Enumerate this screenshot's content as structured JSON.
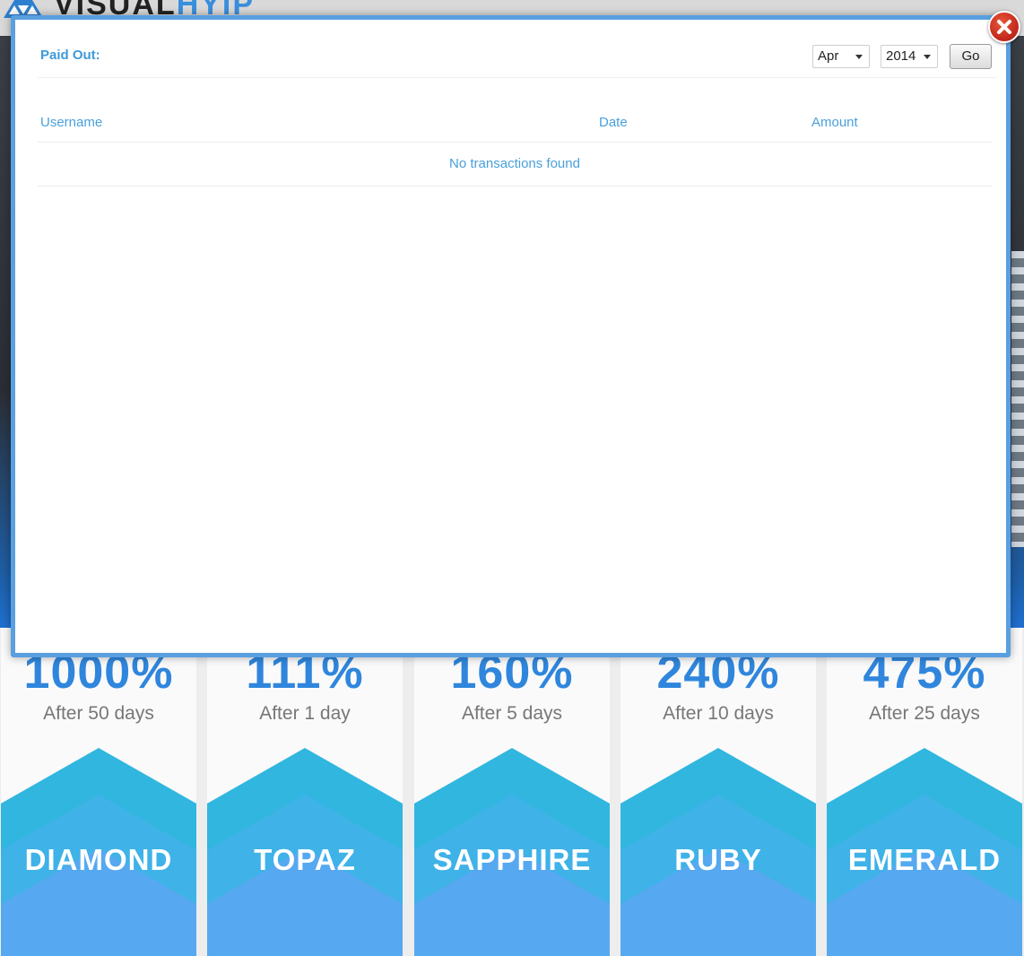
{
  "background": {
    "logo": {
      "text_dark": "VISUAL",
      "text_accent": "HYIP"
    },
    "plans": [
      {
        "percent": "1000%",
        "days": "After 50 days",
        "name": "DIAMOND"
      },
      {
        "percent": "111%",
        "days": "After 1 day",
        "name": "TOPAZ"
      },
      {
        "percent": "160%",
        "days": "After 5 days",
        "name": "SAPPHIRE"
      },
      {
        "percent": "240%",
        "days": "After 10 days",
        "name": "RUBY"
      },
      {
        "percent": "475%",
        "days": "After 25 days",
        "name": "EMERALD"
      }
    ]
  },
  "modal": {
    "close_icon": "close-icon",
    "filter": {
      "title": "Paid Out:",
      "month": "Apr",
      "year": "2014",
      "go_label": "Go"
    },
    "table": {
      "columns": [
        "Username",
        "Date",
        "Amount"
      ],
      "empty_message": "No transactions found"
    }
  },
  "colors": {
    "accent": "#3e9ad8",
    "modal_border": "#5a9fe0",
    "close_red": "#c0261a",
    "plan_blue": "#2f86dc",
    "hex_top": "#2bb8de",
    "hex_bottom": "#57a8f0"
  }
}
